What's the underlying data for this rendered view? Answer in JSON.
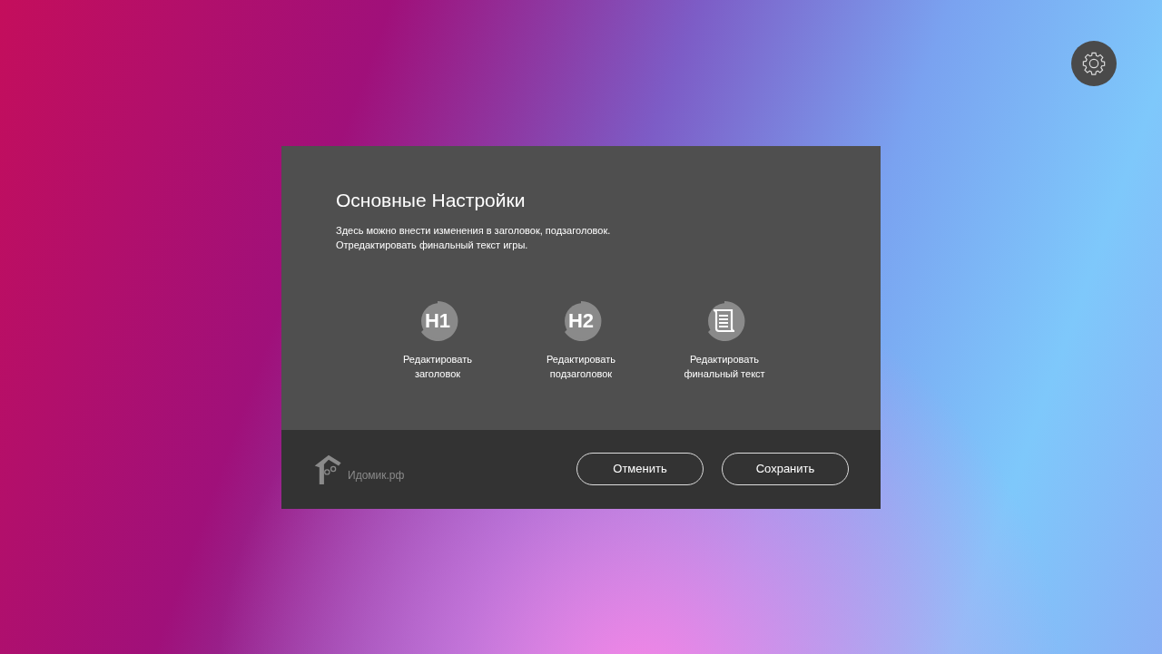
{
  "dialog": {
    "title": "Основные Настройки",
    "description": [
      "Здесь можно внести изменения в заголовок, подзаголовок.",
      "Отредактировать финальный текст игры."
    ],
    "actions": [
      {
        "kind": "text",
        "badge": "H1",
        "label": [
          "Редактировать",
          "заголовок"
        ]
      },
      {
        "kind": "text",
        "badge": "H2",
        "label": [
          "Редактировать",
          "подзаголовок"
        ]
      },
      {
        "kind": "scroll",
        "label": [
          "Редактировать",
          "финальный текст"
        ]
      }
    ],
    "footer": {
      "logo_text": "Идомик.рф",
      "buttons": [
        "Отменить",
        "Сохранить"
      ]
    }
  }
}
